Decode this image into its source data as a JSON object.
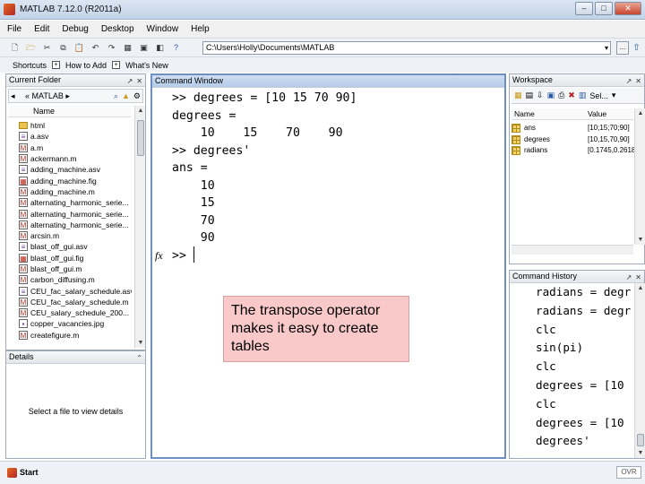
{
  "window": {
    "title": "MATLAB 7.12.0 (R2011a)",
    "minimize": "–",
    "maximize": "□",
    "close": "✕"
  },
  "menu": [
    "File",
    "Edit",
    "Debug",
    "Desktop",
    "Window",
    "Help"
  ],
  "toolbar": {
    "current_folder_label": "",
    "current_folder_path": "C:\\Users\\Holly\\Documents\\MATLAB",
    "browse_label": "..."
  },
  "shortcuts": [
    "Shortcuts",
    "How to Add",
    "What's New"
  ],
  "current_folder": {
    "title": "Current Folder",
    "address": "« MATLAB ▸",
    "column_name": "Name",
    "files": [
      {
        "name": "html",
        "kind": "folder"
      },
      {
        "name": "a.asv",
        "kind": "asv"
      },
      {
        "name": "a.m",
        "kind": "m"
      },
      {
        "name": "ackermann.m",
        "kind": "m"
      },
      {
        "name": "adding_machine.asv",
        "kind": "asv"
      },
      {
        "name": "adding_machine.fig",
        "kind": "fig"
      },
      {
        "name": "adding_machine.m",
        "kind": "m"
      },
      {
        "name": "alternating_harmonic_serie...",
        "kind": "m"
      },
      {
        "name": "alternating_harmonic_serie...",
        "kind": "m"
      },
      {
        "name": "alternating_harmonic_serie...",
        "kind": "m"
      },
      {
        "name": "arcsin.m",
        "kind": "m"
      },
      {
        "name": "blast_off_gui.asv",
        "kind": "asv"
      },
      {
        "name": "blast_off_gui.fig",
        "kind": "fig"
      },
      {
        "name": "blast_off_gui.m",
        "kind": "m"
      },
      {
        "name": "carbon_diffusing.m",
        "kind": "m"
      },
      {
        "name": "CEU_fac_salary_schedule.asv",
        "kind": "asv"
      },
      {
        "name": "CEU_fac_salary_schedule.m",
        "kind": "m"
      },
      {
        "name": "CEU_salary_schedule_200...",
        "kind": "m"
      },
      {
        "name": "copper_vacancies.jpg",
        "kind": "jpg"
      },
      {
        "name": "createfigure.m",
        "kind": "m"
      }
    ]
  },
  "details": {
    "title": "Details",
    "message": "Select a file to view details"
  },
  "command_window": {
    "title": "Command Window",
    "lines": [
      ">> degrees = [10 15 70 90]",
      "degrees =",
      "    10    15    70    90",
      ">> degrees'",
      "ans =",
      "    10",
      "    15",
      "    70",
      "    90"
    ],
    "fx": "fx",
    "prompt": ">>",
    "callout": "The transpose operator makes it easy to create tables"
  },
  "workspace": {
    "title": "Workspace",
    "select_label": "Sel...",
    "col_name": "Name",
    "col_value": "Value",
    "vars": [
      {
        "name": "ans",
        "value": "[10;15;70;90]"
      },
      {
        "name": "degrees",
        "value": "[10,15,70,90]"
      },
      {
        "name": "radians",
        "value": "[0.1745,0.2618,1..."
      }
    ]
  },
  "command_history": {
    "title": "Command History",
    "entries": [
      "radians = degr",
      "radians = degr",
      "clc",
      "sin(pi)",
      "clc",
      "degrees = [10",
      "clc",
      "degrees = [10",
      "degrees'"
    ]
  },
  "statusbar": {
    "start": "Start",
    "ovr": "OVR"
  }
}
